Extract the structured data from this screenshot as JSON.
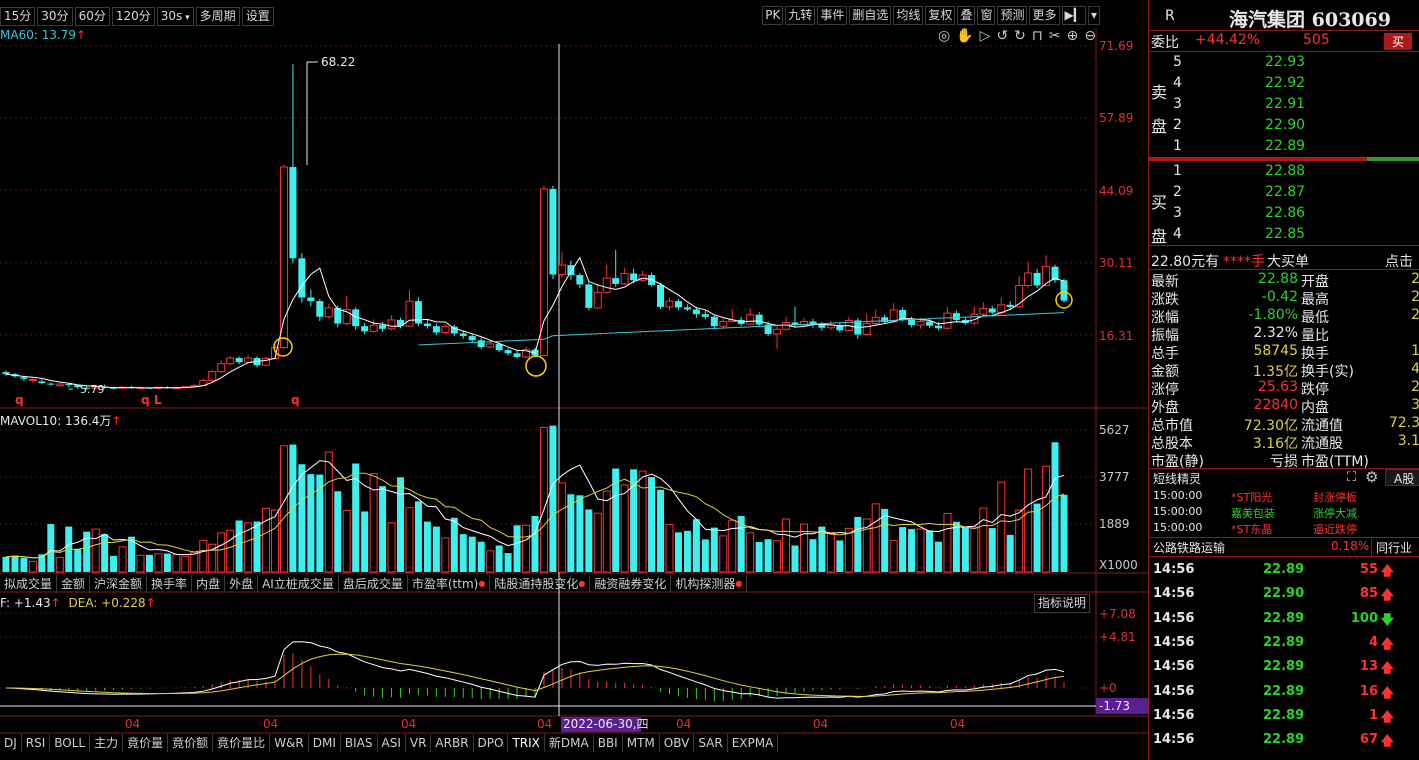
{
  "toolbar": {
    "periods": [
      "15分",
      "30分",
      "60分",
      "120分",
      "30s"
    ],
    "multi_period": "多周期",
    "settings": "设置",
    "right_buttons": [
      "PK",
      "九转",
      "事件",
      "删自选",
      "均线",
      "复权",
      "叠",
      "窗",
      "预测",
      "更多"
    ]
  },
  "kline": {
    "ma_label": "MA60: 13.79",
    "price_ticks": [
      "71.69",
      "57.89",
      "44.09",
      "30.11",
      "16.31"
    ],
    "peak_label": "68.22",
    "low_label": "5.79",
    "markers": [
      "q",
      "q",
      "L",
      "q"
    ]
  },
  "volume": {
    "label": "MAVOL10: 136.4万",
    "ticks": [
      "5627",
      "3777",
      "1889",
      "X1000"
    ]
  },
  "indicator_tabs": [
    "拟成交量",
    "金额",
    "沪深金额",
    "换手率",
    "内盘",
    "外盘",
    "AI立桩成交量",
    "盘后成交量",
    "市盈率(ttm)",
    "陆股通持股变化",
    "融资融券变化",
    "机构探测器"
  ],
  "indicator_tabs_dot": [
    false,
    false,
    false,
    false,
    false,
    false,
    false,
    false,
    true,
    true,
    false,
    true
  ],
  "macd": {
    "label_dif": "F: +1.43",
    "label_dea": "DEA: +0.228",
    "help": "指标说明",
    "ticks": [
      "+7.08",
      "+4.81",
      "+0",
      "-1.73"
    ]
  },
  "x_axis": {
    "labels": [
      "04",
      "04",
      "04",
      "04",
      "04",
      "04",
      "04"
    ],
    "cursor_date": "2022-06-30,四"
  },
  "bottom_tabs": [
    "DJ",
    "RSI",
    "BOLL",
    "主力",
    "竟价量",
    "竟价额",
    "竟价量比",
    "W&R",
    "DMI",
    "BIAS",
    "ASI",
    "VR",
    "ARBR",
    "DPO",
    "TRIX",
    "新DMA",
    "BBI",
    "MTM",
    "OBV",
    "SAR",
    "EXPMA"
  ],
  "stock": {
    "flag": "R",
    "name": "海汽集团",
    "code": "603069",
    "weibi_label": "委比",
    "weibi_value": "+44.42%",
    "weicha": "505",
    "buy_btn": "买",
    "sell_label": "卖盘",
    "buy_label": "买盘",
    "asks": [
      {
        "level": "5",
        "price": "22.93"
      },
      {
        "level": "4",
        "price": "22.92"
      },
      {
        "level": "3",
        "price": "22.91"
      },
      {
        "level": "2",
        "price": "22.90"
      },
      {
        "level": "1",
        "price": "22.89"
      }
    ],
    "bids": [
      {
        "level": "1",
        "price": "22.88"
      },
      {
        "level": "2",
        "price": "22.87"
      },
      {
        "level": "3",
        "price": "22.86"
      },
      {
        "level": "4",
        "price": "22.85"
      }
    ],
    "big_order_price": "22.80元有",
    "big_order_qty": "****手",
    "big_order_label": "大买单",
    "click_label": "点击",
    "stats": [
      {
        "l1": "最新",
        "v1": "22.88",
        "c1": "green",
        "l2": "开盘",
        "v2": "2"
      },
      {
        "l1": "涨跌",
        "v1": "-0.42",
        "c1": "green",
        "l2": "最高",
        "v2": "2"
      },
      {
        "l1": "涨幅",
        "v1": "-1.80%",
        "c1": "green",
        "l2": "最低",
        "v2": "2"
      },
      {
        "l1": "振幅",
        "v1": "2.32%",
        "c1": "white",
        "l2": "量比",
        "v2": ""
      },
      {
        "l1": "总手",
        "v1": "58745",
        "c1": "yellow",
        "l2": "换手",
        "v2": "1"
      },
      {
        "l1": "金额",
        "v1": "1.35亿",
        "c1": "yellow",
        "l2": "换手(实)",
        "v2": "4"
      },
      {
        "l1": "涨停",
        "v1": "25.63",
        "c1": "red",
        "l2": "跌停",
        "v2": "2"
      },
      {
        "l1": "外盘",
        "v1": "22840",
        "c1": "red",
        "l2": "内盘",
        "v2": "3"
      },
      {
        "l1": "总市值",
        "v1": "72.30亿",
        "c1": "yellow",
        "l2": "流通值",
        "v2": "72.3"
      },
      {
        "l1": "总股本",
        "v1": "3.16亿",
        "c1": "yellow",
        "l2": "流通股",
        "v2": "3.1"
      },
      {
        "l1": "市盈(静)",
        "v1": "亏损",
        "c1": "white",
        "l2": "市盈(TTM)",
        "v2": ""
      }
    ],
    "elf_title": "短线精灵",
    "elf_tab": "A股",
    "elf_rows": [
      {
        "time": "15:00:00",
        "name": "*ST阳光",
        "event": "封涨停板",
        "nc": "red",
        "ec": "red"
      },
      {
        "time": "15:00:00",
        "name": "嘉美包装",
        "event": "涨停大减",
        "nc": "green",
        "ec": "green"
      },
      {
        "time": "15:00:00",
        "name": "*ST东晶",
        "event": "逼近跌停",
        "nc": "red",
        "ec": "red"
      }
    ],
    "industry": "公路铁路运输",
    "industry_pct": "0.18%",
    "industry_tab": "同行业",
    "ticks": [
      {
        "time": "14:56",
        "price": "22.89",
        "vol": "55",
        "dir": "up"
      },
      {
        "time": "14:56",
        "price": "22.90",
        "vol": "85",
        "dir": "up"
      },
      {
        "time": "14:56",
        "price": "22.89",
        "vol": "100",
        "dir": "down"
      },
      {
        "time": "14:56",
        "price": "22.89",
        "vol": "4",
        "dir": "up"
      },
      {
        "time": "14:56",
        "price": "22.89",
        "vol": "13",
        "dir": "up"
      },
      {
        "time": "14:56",
        "price": "22.89",
        "vol": "16",
        "dir": "up"
      },
      {
        "time": "14:56",
        "price": "22.89",
        "vol": "1",
        "dir": "up"
      },
      {
        "time": "14:56",
        "price": "22.89",
        "vol": "67",
        "dir": "up"
      }
    ]
  },
  "colors": {
    "up": "#ff3030",
    "down": "#3cf0f0",
    "ma5": "#ffffff",
    "ma10": "#e0d040",
    "ma60": "#3cc8d8"
  }
}
